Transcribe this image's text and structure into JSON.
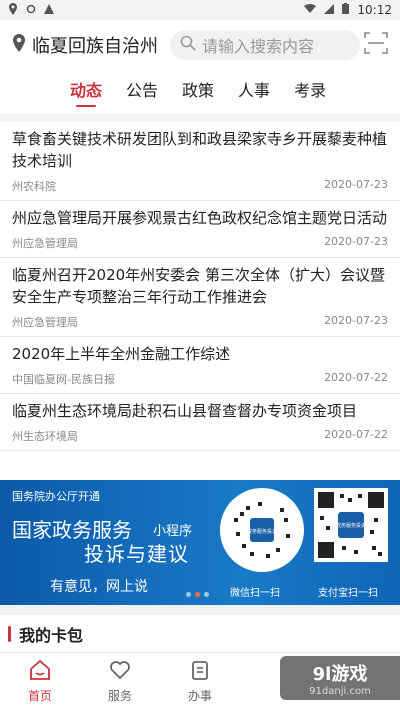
{
  "status_bar": {
    "time": "10:12",
    "icons": [
      "location-pin-icon",
      "settings-icon",
      "warning-icon"
    ],
    "right_icons": [
      "wifi-icon",
      "signal-icon",
      "battery-icon"
    ]
  },
  "header": {
    "location": "临夏回族自治州",
    "search_placeholder": "请输入搜索内容"
  },
  "tabs": [
    {
      "label": "动态",
      "active": true
    },
    {
      "label": "公告",
      "active": false
    },
    {
      "label": "政策",
      "active": false
    },
    {
      "label": "人事",
      "active": false
    },
    {
      "label": "考录",
      "active": false
    }
  ],
  "news": [
    {
      "title": "草食畜关键技术研发团队到和政县梁家寺乡开展藜麦种植技术培训",
      "source": "州农科院",
      "date": "2020-07-23"
    },
    {
      "title": "州应急管理局开展参观景古红色政权纪念馆主题党日活动",
      "source": "州应急管理局",
      "date": "2020-07-23"
    },
    {
      "title": "临夏州召开2020年州安委会 第三次全体（扩大）会议暨安全生产专项整治三年行动工作推进会",
      "source": "州应急管理局",
      "date": "2020-07-23"
    },
    {
      "title": "2020年上半年全州金融工作综述",
      "source": "中国临夏网-民族日报",
      "date": "2020-07-22"
    },
    {
      "title": "临夏州生态环境局赴积石山县督查督办专项资金项目",
      "source": "州生态环境局",
      "date": "2020-07-22"
    }
  ],
  "banner": {
    "top_text": "国务院办公厅开通",
    "title": "国家政务服务",
    "mini_program": "小程序",
    "subtitle": "投诉与建议",
    "slogan": "有意见，网上说",
    "qr_a_label": "微信扫一扫",
    "qr_b_label": "支付宝扫一扫",
    "qr_a_center": "政务服务投诉",
    "qr_b_center": "政务服务投诉",
    "dots": 3,
    "active_dot": 1
  },
  "card_section": {
    "title": "我的卡包"
  },
  "bottom_nav": [
    {
      "label": "首页",
      "icon": "home-icon",
      "active": true
    },
    {
      "label": "服务",
      "icon": "heart-icon",
      "active": false
    },
    {
      "label": "办事",
      "icon": "clipboard-icon",
      "active": false
    }
  ],
  "watermark": {
    "main": "9l游戏",
    "sub": "91danji.com"
  },
  "colors": {
    "accent": "#c9353a",
    "banner_blue": "#1a7ac7"
  }
}
